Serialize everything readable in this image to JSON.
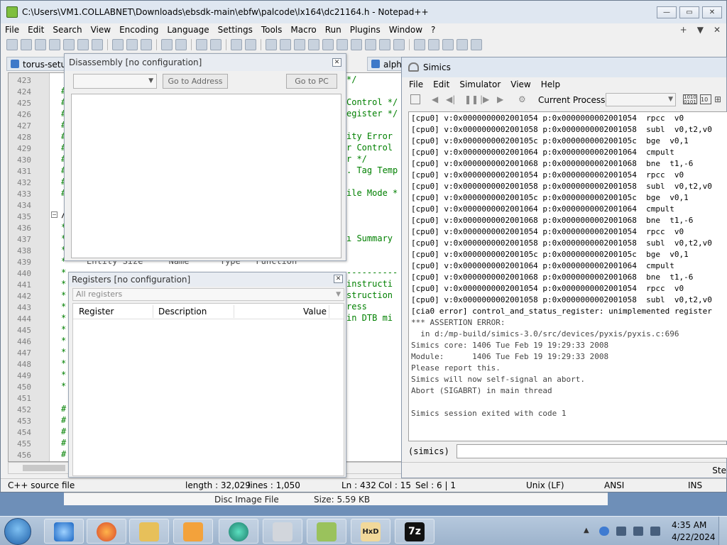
{
  "notepad": {
    "title": "C:\\Users\\VM1.COLLABNET\\Downloads\\ebsdk-main\\ebfw\\palcode\\lx164\\dc21164.h - Notepad++",
    "window_buttons": {
      "minimize": "—",
      "restore": "▭",
      "close": "✕"
    },
    "menu": [
      "File",
      "Edit",
      "Search",
      "View",
      "Encoding",
      "Language",
      "Settings",
      "Tools",
      "Macro",
      "Run",
      "Plugins",
      "Window",
      "?"
    ],
    "menu_right": [
      "+",
      "▼",
      "✕"
    ],
    "tabs": [
      "torus-setup",
      "alpha"
    ],
    "line_numbers": [
      "423",
      "424",
      "425",
      "426",
      "427",
      "428",
      "429",
      "430",
      "431",
      "432",
      "433",
      "434",
      "435",
      "436",
      "437",
      "438",
      "439",
      "440",
      "441",
      "442",
      "443",
      "444",
      "445",
      "446",
      "447",
      "448",
      "449",
      "450",
      "451",
      "452",
      "453",
      "454",
      "455",
      "456"
    ],
    "code_fragments": [
      {
        "line": "423",
        "text": "*/"
      },
      {
        "line": "425",
        "text": "Control */"
      },
      {
        "line": "426",
        "text": "egister */"
      },
      {
        "line": "428",
        "text": "ity Error"
      },
      {
        "line": "429",
        "text": "r Control"
      },
      {
        "line": "430",
        "text": "r */"
      },
      {
        "line": "431",
        "text": ". Tag Temp"
      },
      {
        "line": "433",
        "text": "ile Mode *"
      },
      {
        "line": "437",
        "text": "ı Summary"
      },
      {
        "line": "440",
        "text": "----------"
      },
      {
        "line": "441",
        "text": "instructi"
      },
      {
        "line": "442",
        "text": "struction"
      },
      {
        "line": "443",
        "text": "ress"
      },
      {
        "line": "444",
        "text": "in DTB mi"
      }
    ],
    "left_code": {
      "424": "#",
      "425": "#",
      "426": "#",
      "427": "#",
      "428": "#",
      "429": "#",
      "430": "#",
      "431": "#",
      "432": "#",
      "433": "#",
      "436": "*",
      "437": "*",
      "438": "*",
      "439": "*",
      "440": "*",
      "441": "*",
      "442": "*",
      "443": "*",
      "444": "*",
      "445": "*",
      "446": "*",
      "447": "*",
      "448": "*",
      "449": "*",
      "450": "*",
      "452": "#",
      "453": "#",
      "454": "#",
      "455": "#",
      "456": "#"
    },
    "fold_marker": "−",
    "fold_line_text": "/",
    "hidden_row_439": "Entity Size     Name      Type   Function",
    "status": {
      "file_type": "C++ source file",
      "length": "length : 32,029",
      "lines": "lines : 1,050",
      "ln": "Ln : 432",
      "col": "Col : 15",
      "sel": "Sel : 6 | 1",
      "eol": "Unix (LF)",
      "encoding": "ANSI",
      "mode": "INS"
    }
  },
  "disassembly": {
    "title": "Disassembly [no configuration]",
    "go_to_address": "Go to Address",
    "go_to_pc": "Go to PC",
    "close": "✕"
  },
  "registers": {
    "title": "Registers [no configuration]",
    "filter": "All registers",
    "columns": [
      "Register",
      "Description",
      "Value"
    ],
    "close": "✕"
  },
  "simics": {
    "title": "Simics",
    "menu": [
      "File",
      "Edit",
      "Simulator",
      "View",
      "Help"
    ],
    "current_processor_label": "Current Processor:",
    "console_lines": [
      "[cpu0] v:0x0000000002001054 p:0x0000000002001054  rpcc  v0",
      "[cpu0] v:0x0000000002001058 p:0x0000000002001058  subl  v0,t2,v0",
      "[cpu0] v:0x000000000200105c p:0x000000000200105c  bge  v0,1",
      "[cpu0] v:0x0000000002001064 p:0x0000000002001064  cmpult",
      "[cpu0] v:0x0000000002001068 p:0x0000000002001068  bne  t1,-6",
      "[cpu0] v:0x0000000002001054 p:0x0000000002001054  rpcc  v0",
      "[cpu0] v:0x0000000002001058 p:0x0000000002001058  subl  v0,t2,v0",
      "[cpu0] v:0x000000000200105c p:0x000000000200105c  bge  v0,1",
      "[cpu0] v:0x0000000002001064 p:0x0000000002001064  cmpult",
      "[cpu0] v:0x0000000002001068 p:0x0000000002001068  bne  t1,-6",
      "[cpu0] v:0x0000000002001054 p:0x0000000002001054  rpcc  v0",
      "[cpu0] v:0x0000000002001058 p:0x0000000002001058  subl  v0,t2,v0",
      "[cpu0] v:0x000000000200105c p:0x000000000200105c  bge  v0,1",
      "[cpu0] v:0x0000000002001064 p:0x0000000002001064  cmpult",
      "[cpu0] v:0x0000000002001068 p:0x0000000002001068  bne  t1,-6",
      "[cpu0] v:0x0000000002001054 p:0x0000000002001054  rpcc  v0",
      "[cpu0] v:0x0000000002001058 p:0x0000000002001058  subl  v0,t2,v0",
      "[cia0 error] control_and_status_register: unimplemented register",
      "*** ASSERTION ERROR:",
      "  in d:/mp-build/simics-3.0/src/devices/pyxis/pyxis.c:696",
      "Simics core: 1406 Tue Feb 19 19:29:33 2008",
      "Module:      1406 Tue Feb 19 19:29:33 2008",
      "Please report this.",
      "Simics will now self-signal an abort.",
      "Abort (SIGABRT) in main thread",
      "",
      "Simics session exited with code 1"
    ],
    "prompt": "(simics)",
    "status_right": "Ste"
  },
  "behind_window": {
    "left_text": "Disc Image File",
    "size_text": "Size: 5.59 KB"
  },
  "taskbar": {
    "apps": [
      "internet-explorer",
      "firefox",
      "file-explorer",
      "media-player",
      "tortoise",
      "simics",
      "notepad-plus-plus",
      "hxd",
      "7zip"
    ],
    "app_labels": {
      "seven_zip": "7z",
      "hxd": "HxD"
    },
    "time": "4:35 AM",
    "date": "4/22/2024"
  }
}
